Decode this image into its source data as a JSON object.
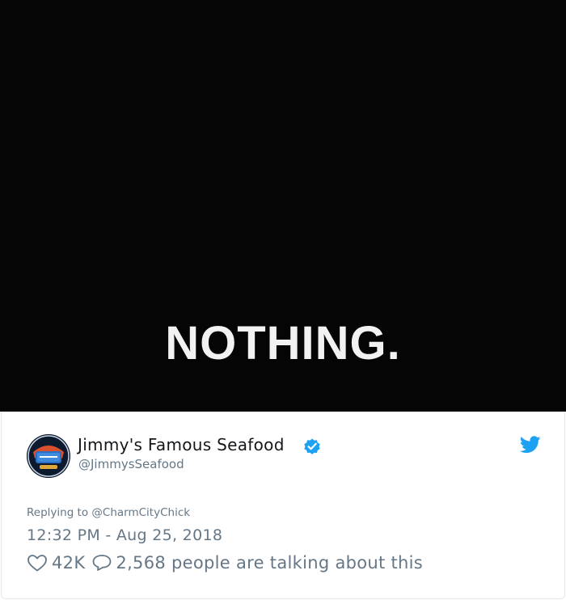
{
  "media": {
    "caption": "NOTHING."
  },
  "tweet": {
    "display_name": "Jimmy's Famous Seafood",
    "handle": "@JimmysSeafood",
    "avatar_text": "JIMMY'S",
    "replying_to_label": "Replying to",
    "replying_to_user": "@CharmCityChick",
    "timestamp": "12:32 PM - Aug 25, 2018",
    "like_count": "42K",
    "talking_text": "2,568 people are talking about this"
  },
  "colors": {
    "media_bg": "#050505",
    "verified_blue": "#1DA1F2",
    "twitter_blue": "#1DA1F2",
    "muted_text": "#657786",
    "name_text": "#14171a"
  },
  "icons": [
    "verified-badge-icon",
    "twitter-bird-icon",
    "heart-icon",
    "comment-bubble-icon"
  ]
}
